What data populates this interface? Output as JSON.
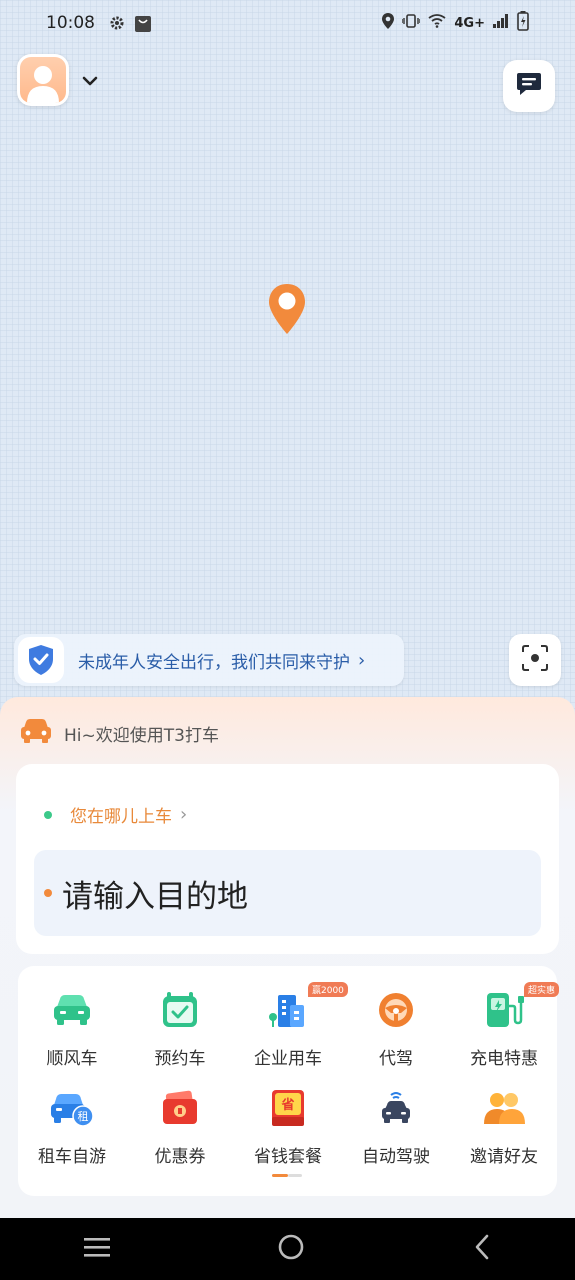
{
  "status_bar": {
    "time": "10:08",
    "network": "4G+"
  },
  "header": {
    "avatar": "user-avatar",
    "menu": "chevron-down-icon",
    "messages": "message-icon"
  },
  "map": {
    "pin": "location-pin-icon"
  },
  "safety_banner": {
    "text": "未成年人安全出行，我们共同来守护",
    "arrow": "›"
  },
  "welcome": {
    "text": "Hi~欢迎使用T3打车"
  },
  "destination_card": {
    "pickup_label": "您在哪儿上车",
    "pickup_arrow": "›",
    "destination_placeholder": "请输入目的地"
  },
  "services": [
    {
      "label": "顺风车",
      "icon": "car-icon",
      "badge": ""
    },
    {
      "label": "预约车",
      "icon": "calendar-check-icon",
      "badge": ""
    },
    {
      "label": "企业用车",
      "icon": "building-icon",
      "badge": "赢2000"
    },
    {
      "label": "代驾",
      "icon": "steering-wheel-icon",
      "badge": ""
    },
    {
      "label": "充电特惠",
      "icon": "charging-icon",
      "badge": "超实惠"
    },
    {
      "label": "租车自游",
      "icon": "rental-car-icon",
      "badge": "",
      "icon_text": "租"
    },
    {
      "label": "优惠券",
      "icon": "coupon-icon",
      "badge": ""
    },
    {
      "label": "省钱套餐",
      "icon": "savings-icon",
      "badge": "",
      "icon_text": "省"
    },
    {
      "label": "自动驾驶",
      "icon": "autonomous-car-icon",
      "badge": ""
    },
    {
      "label": "邀请好友",
      "icon": "invite-friends-icon",
      "badge": ""
    }
  ],
  "colors": {
    "accent_orange": "#f28a3c",
    "green": "#3cc98a",
    "blue": "#2a5da8"
  }
}
